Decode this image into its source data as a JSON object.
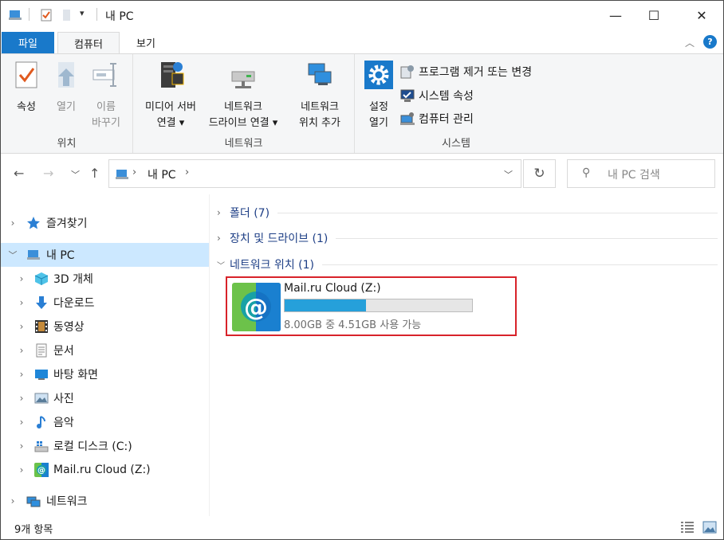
{
  "window": {
    "title": "내 PC",
    "controls": {
      "minimize": "—",
      "maximize": "☐",
      "close": "✕"
    }
  },
  "ribbon_tabs": [
    {
      "label": "파일"
    },
    {
      "label": "컴퓨터"
    },
    {
      "label": "보기"
    }
  ],
  "ribbon": {
    "groups": {
      "location": {
        "label": "위치",
        "buttons": [
          {
            "line1": "속성",
            "line2": ""
          },
          {
            "line1": "열기",
            "line2": ""
          },
          {
            "line1": "이름",
            "line2": "바꾸기"
          }
        ]
      },
      "network": {
        "label": "네트워크",
        "buttons": [
          {
            "line1": "미디어 서버",
            "line2": "연결 ▾"
          },
          {
            "line1": "네트워크",
            "line2": "드라이브 연결 ▾"
          },
          {
            "line1": "네트워크",
            "line2": "위치 추가"
          }
        ]
      },
      "system": {
        "label": "시스템",
        "open_settings": {
          "line1": "설정",
          "line2": "열기"
        },
        "items": [
          {
            "label": "프로그램 제거 또는 변경"
          },
          {
            "label": "시스템 속성"
          },
          {
            "label": "컴퓨터 관리"
          }
        ]
      }
    }
  },
  "address_bar": {
    "path": [
      "내 PC"
    ],
    "separator": "›",
    "search_placeholder": "내 PC 검색"
  },
  "nav_pane": {
    "items": [
      {
        "label": "즐겨찾기",
        "icon": "star-icon",
        "level": 0,
        "expanded": false
      },
      {
        "label": "내 PC",
        "icon": "pc-icon",
        "level": 0,
        "expanded": true,
        "selected": true
      },
      {
        "label": "3D 개체",
        "icon": "cube-icon",
        "level": 1
      },
      {
        "label": "다운로드",
        "icon": "download-icon",
        "level": 1
      },
      {
        "label": "동영상",
        "icon": "video-icon",
        "level": 1
      },
      {
        "label": "문서",
        "icon": "document-icon",
        "level": 1
      },
      {
        "label": "바탕 화면",
        "icon": "desktop-icon",
        "level": 1
      },
      {
        "label": "사진",
        "icon": "picture-icon",
        "level": 1
      },
      {
        "label": "음악",
        "icon": "music-icon",
        "level": 1
      },
      {
        "label": "로컬 디스크 (C:)",
        "icon": "disk-icon",
        "level": 1
      },
      {
        "label": "Mail.ru Cloud (Z:)",
        "icon": "mailru-icon",
        "level": 1
      },
      {
        "label": "네트워크",
        "icon": "network-icon",
        "level": 0,
        "expanded": false
      }
    ]
  },
  "content": {
    "sections": [
      {
        "label": "폴더 (7)",
        "expanded": false
      },
      {
        "label": "장치 및 드라이브 (1)",
        "expanded": false
      },
      {
        "label": "네트워크 위치 (1)",
        "expanded": true
      }
    ],
    "drive": {
      "name": "Mail.ru Cloud (Z:)",
      "free_text": "8.00GB 중 4.51GB 사용 가능",
      "used_fraction": 0.436
    }
  },
  "status_bar": {
    "item_count": "9개 항목"
  },
  "colors": {
    "accent": "#1979ca",
    "selection": "#cce8ff",
    "section_text": "#1e3f86",
    "highlight_border": "#d8232a",
    "bar_fill": "#26a0da"
  }
}
